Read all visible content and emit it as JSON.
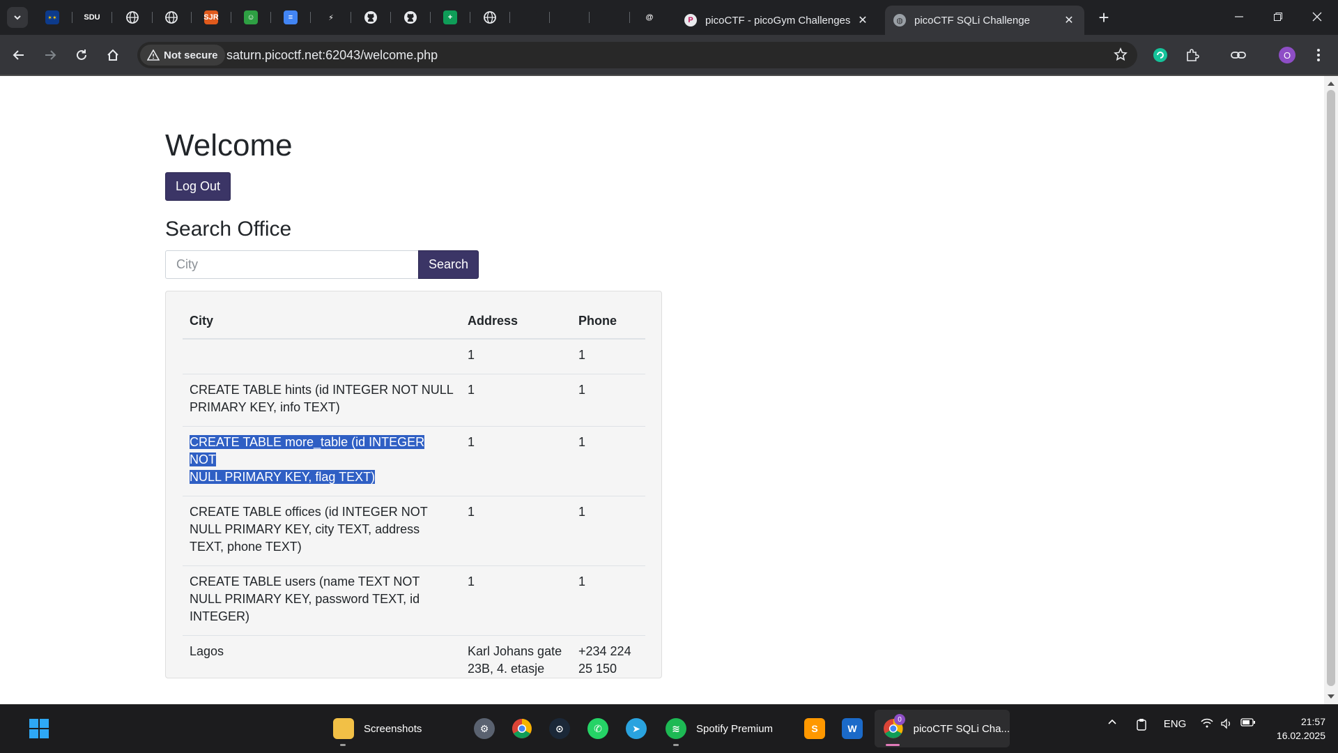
{
  "browser": {
    "pinned_tabs": [
      {
        "icon": "eu-flag-icon",
        "color": "#0d3b8c",
        "text": ""
      },
      {
        "icon": "sdu-logo-icon",
        "color": "#202124",
        "text": "SDU"
      },
      {
        "icon": "globe-icon",
        "color": "#202124",
        "text": ""
      },
      {
        "icon": "globe-icon",
        "color": "#202124",
        "text": ""
      },
      {
        "icon": "sjr-icon",
        "color": "#e05a1c",
        "text": "SJR"
      },
      {
        "icon": "smiley-icon",
        "color": "#2ea043",
        "text": "☺"
      },
      {
        "icon": "google-docs-icon",
        "color": "#4285f4",
        "text": "≡"
      },
      {
        "icon": "sublime-icon",
        "color": "#202124",
        "text": "⚡"
      },
      {
        "icon": "github-icon",
        "color": "#202124",
        "text": ""
      },
      {
        "icon": "github-icon",
        "color": "#202124",
        "text": ""
      },
      {
        "icon": "google-sheets-icon",
        "color": "#0f9d58",
        "text": "+"
      },
      {
        "icon": "globe-icon",
        "color": "#202124",
        "text": ""
      },
      {
        "icon": "ctf-logo-icon",
        "color": "#202124",
        "text": ""
      },
      {
        "icon": "cloud-icon",
        "color": "#202124",
        "text": ""
      },
      {
        "icon": "arrow-logo-icon",
        "color": "#202124",
        "text": ""
      },
      {
        "icon": "threads-icon",
        "color": "#202124",
        "text": "@"
      }
    ],
    "tabs": [
      {
        "title": "picoCTF - picoGym Challenges",
        "close": "✕"
      },
      {
        "title": "picoCTF SQLi Challenge",
        "close": "✕"
      }
    ],
    "new_tab": "+",
    "security_label": "Not secure",
    "url": "saturn.picoctf.net:62043/welcome.php",
    "profile_initial": "O",
    "accent": "#8e4ec6"
  },
  "page": {
    "title": "Welcome",
    "logout_label": "Log Out",
    "search_heading": "Search Office",
    "search_placeholder": "City",
    "search_button": "Search",
    "button_color": "#3b3566",
    "table": {
      "headers": [
        "City",
        "Address",
        "Phone"
      ],
      "rows": [
        {
          "city": "",
          "address": "1",
          "phone": "1"
        },
        {
          "city": "CREATE TABLE hints (id INTEGER NOT NULL PRIMARY KEY, info TEXT)",
          "address": "1",
          "phone": "1"
        },
        {
          "city_line1": "CREATE TABLE more_table (id INTEGER NOT",
          "city_line2": "NULL PRIMARY KEY, flag TEXT)",
          "address": "1",
          "phone": "1",
          "selected": true
        },
        {
          "city": "CREATE TABLE offices (id INTEGER NOT NULL PRIMARY KEY, city TEXT, address TEXT, phone TEXT)",
          "address": "1",
          "phone": "1"
        },
        {
          "city": "CREATE TABLE users (name TEXT NOT NULL PRIMARY KEY, password TEXT, id INTEGER)",
          "address": "1",
          "phone": "1"
        },
        {
          "city": "Lagos",
          "address": "Karl Johans gate 23B, 4. etasje",
          "phone": "+234 224 25 150"
        }
      ]
    }
  },
  "taskbar": {
    "items": [
      {
        "icon": "folder-icon",
        "label": "Screenshots"
      },
      {
        "icon": "settings-icon",
        "label": ""
      },
      {
        "icon": "chrome-icon",
        "label": ""
      },
      {
        "icon": "steam-icon",
        "label": ""
      },
      {
        "icon": "whatsapp-icon",
        "label": ""
      },
      {
        "icon": "telegram-icon",
        "label": ""
      },
      {
        "icon": "spotify-icon",
        "label": "Spotify Premium"
      },
      {
        "icon": "sublime-text-icon",
        "label": ""
      },
      {
        "icon": "webstorm-icon",
        "label": ""
      },
      {
        "icon": "chrome-profile-icon",
        "label": "picoCTF SQLi Cha...",
        "badge": "0"
      }
    ],
    "tray": {
      "language": "ENG",
      "time": "21:57",
      "date": "16.02.2025"
    }
  }
}
